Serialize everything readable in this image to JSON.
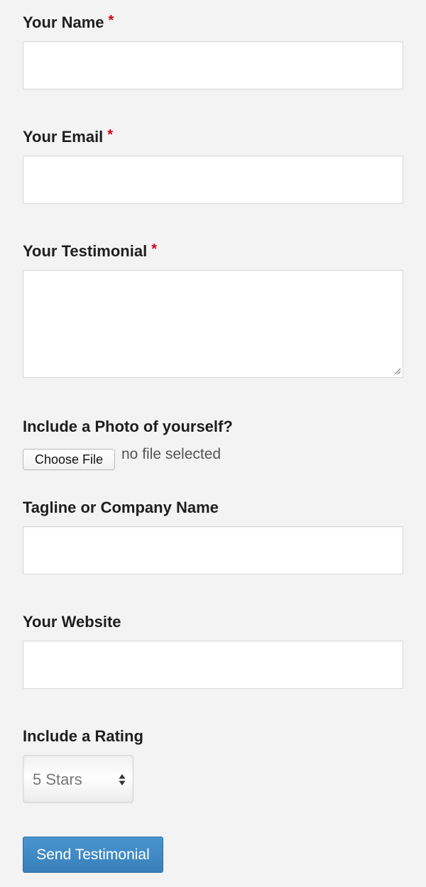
{
  "form": {
    "name": {
      "label": "Your Name",
      "required_mark": "*",
      "value": ""
    },
    "email": {
      "label": "Your Email",
      "required_mark": "*",
      "value": ""
    },
    "testimonial": {
      "label": "Your Testimonial",
      "required_mark": "*",
      "value": ""
    },
    "photo": {
      "label": "Include a Photo of yourself?",
      "button_label": "Choose File",
      "status": "no file selected"
    },
    "tagline": {
      "label": "Tagline or Company Name",
      "value": ""
    },
    "website": {
      "label": "Your Website",
      "value": ""
    },
    "rating": {
      "label": "Include a Rating",
      "selected": "5 Stars"
    },
    "submit_label": "Send Testimonial"
  },
  "colors": {
    "page_background": "#f3f3f3",
    "required": "#d0021b",
    "primary_button": "#3f88c5"
  },
  "icons": {
    "resize": "textarea-resize-icon",
    "select": "select-arrows-icon"
  }
}
